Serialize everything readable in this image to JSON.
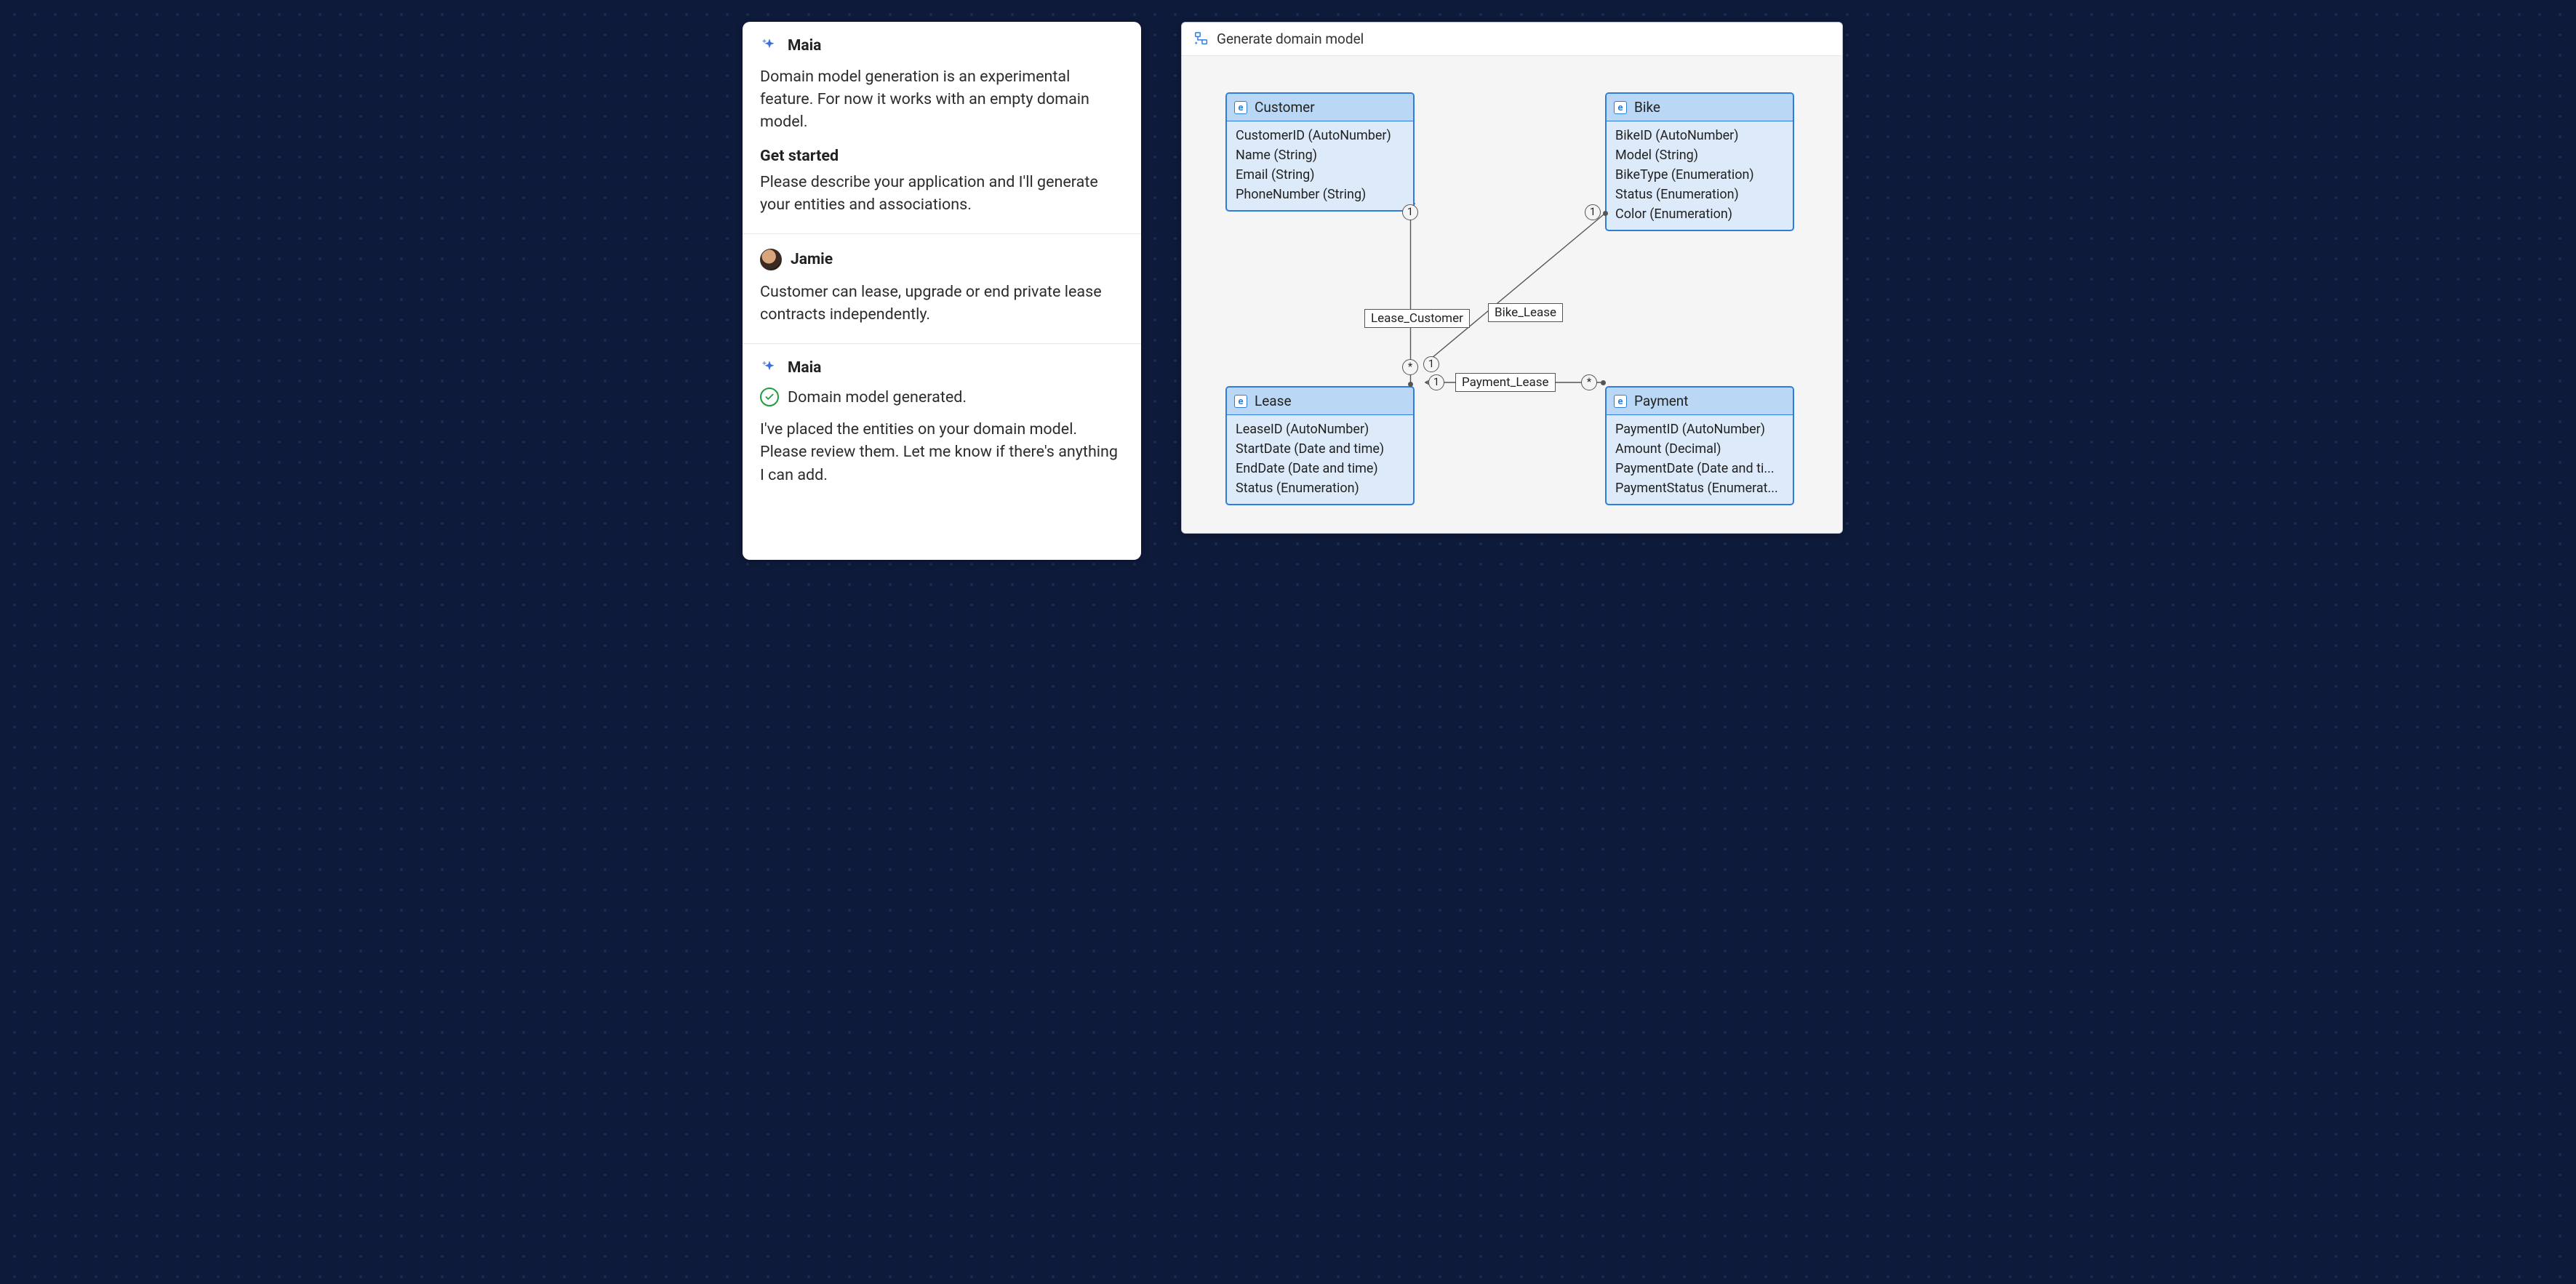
{
  "chat": {
    "maia_name": "Maia",
    "jamie_name": "Jamie",
    "msg1_p1": "Domain model generation is an experimental feature. For now it works with an empty domain model.",
    "msg1_h": "Get started",
    "msg1_p2": "Please describe your application and I'll generate your entities and associations.",
    "msg2": "Customer can lease, upgrade or end private lease contracts independently.",
    "msg3_status": "Domain model generated.",
    "msg3_p": "I've placed the entities on your domain model. Please review them. Let me know if there's anything I can add."
  },
  "diagram": {
    "title": "Generate domain model",
    "entities": {
      "customer": {
        "name": "Customer",
        "attrs": [
          "CustomerID (AutoNumber)",
          "Name (String)",
          "Email (String)",
          "PhoneNumber (String)"
        ]
      },
      "bike": {
        "name": "Bike",
        "attrs": [
          "BikeID (AutoNumber)",
          "Model (String)",
          "BikeType (Enumeration)",
          "Status (Enumeration)",
          "Color (Enumeration)"
        ]
      },
      "lease": {
        "name": "Lease",
        "attrs": [
          "LeaseID (AutoNumber)",
          "StartDate (Date and time)",
          "EndDate (Date and time)",
          "Status (Enumeration)"
        ]
      },
      "payment": {
        "name": "Payment",
        "attrs": [
          "PaymentID (AutoNumber)",
          "Amount (Decimal)",
          "PaymentDate (Date and ti...",
          "PaymentStatus (Enumerat..."
        ]
      }
    },
    "assoc": {
      "lease_customer": {
        "label": "Lease_Customer",
        "from": "*",
        "to": "1"
      },
      "bike_lease": {
        "label": "Bike_Lease",
        "from": "1",
        "to": "1"
      },
      "payment_lease": {
        "label": "Payment_Lease",
        "from": "*",
        "to": "1"
      }
    }
  }
}
